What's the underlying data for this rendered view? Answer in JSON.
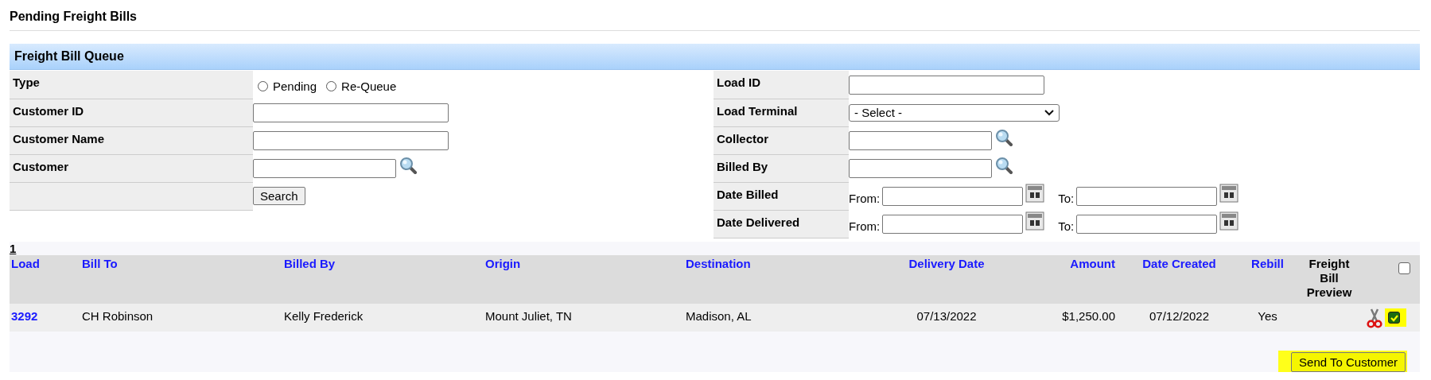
{
  "page": {
    "title": "Pending Freight Bills"
  },
  "queue": {
    "title": "Freight Bill Queue",
    "left_fields": [
      {
        "kind": "radio",
        "label": "Type",
        "options": [
          {
            "label": "Pending",
            "selected": false
          },
          {
            "label": "Re-Queue",
            "selected": false
          }
        ]
      },
      {
        "kind": "text",
        "label": "Customer ID"
      },
      {
        "kind": "text",
        "label": "Customer Name"
      },
      {
        "kind": "lookup",
        "label": "Customer"
      },
      {
        "kind": "button",
        "button": "Search"
      }
    ],
    "right_fields": [
      {
        "kind": "text",
        "label": "Load ID"
      },
      {
        "kind": "select",
        "label": "Load Terminal",
        "value": "- Select -"
      },
      {
        "kind": "lookup",
        "label": "Collector"
      },
      {
        "kind": "lookup",
        "label": "Billed By"
      },
      {
        "kind": "daterange",
        "label": "Date Billed",
        "from": "From:",
        "to": "To:"
      },
      {
        "kind": "daterange",
        "label": "Date Delivered",
        "from": "From:",
        "to": "To:"
      }
    ]
  },
  "results": {
    "pages": [
      "1"
    ],
    "columns": [
      {
        "label": "Load",
        "sortable": true
      },
      {
        "label": "Bill To",
        "sortable": true
      },
      {
        "label": "Billed By",
        "sortable": true
      },
      {
        "label": "Origin",
        "sortable": true
      },
      {
        "label": "Destination",
        "sortable": true
      },
      {
        "label": "Delivery Date",
        "sortable": true
      },
      {
        "label": "Amount",
        "sortable": true
      },
      {
        "label": "Date Created",
        "sortable": true
      },
      {
        "label": "Rebill",
        "sortable": true
      },
      {
        "label": "Freight Bill Preview",
        "sortable": false
      }
    ],
    "select_all": {
      "checked": false
    },
    "rows": [
      {
        "cells": [
          "3292",
          "CH Robinson",
          "Kelly Frederick",
          "Mount Juliet, TN",
          "Madison, AL",
          "07/13/2022",
          "$1,250.00",
          "07/12/2022",
          "Yes"
        ],
        "checked": true,
        "highlighted": true
      }
    ],
    "send_button": {
      "label": "Send To Customer",
      "highlighted": true
    }
  }
}
